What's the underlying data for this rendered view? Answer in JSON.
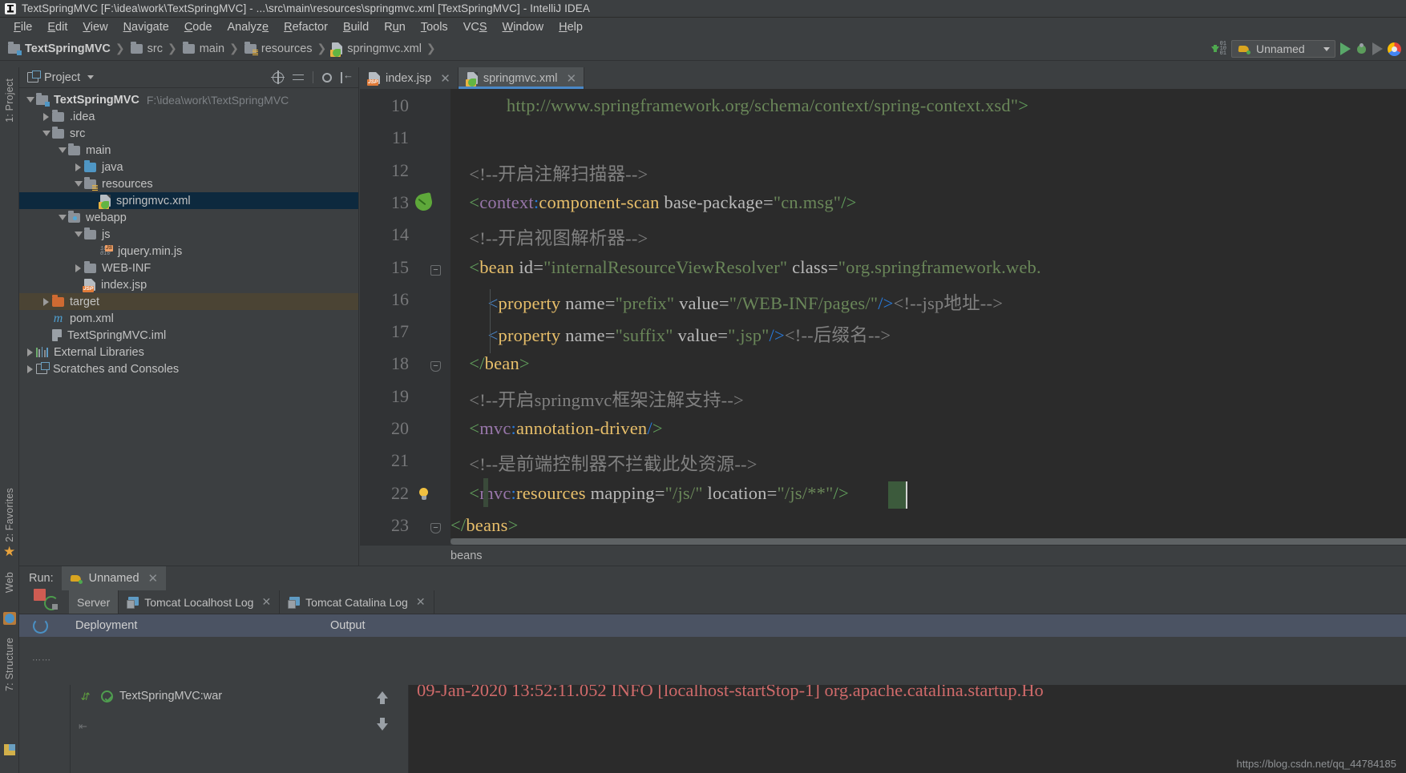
{
  "window": {
    "title": "TextSpringMVC [F:\\idea\\work\\TextSpringMVC] - ...\\src\\main\\resources\\springmvc.xml [TextSpringMVC] - IntelliJ IDEA",
    "logo_icon": "intellij-logo-icon"
  },
  "menubar": {
    "items": [
      "File",
      "Edit",
      "View",
      "Navigate",
      "Code",
      "Analyze",
      "Refactor",
      "Build",
      "Run",
      "Tools",
      "VCS",
      "Window",
      "Help"
    ]
  },
  "navbar": {
    "breadcrumbs": [
      {
        "label": "TextSpringMVC",
        "icon": "module-icon",
        "bold": true
      },
      {
        "label": "src",
        "icon": "folder-icon",
        "bold": false
      },
      {
        "label": "main",
        "icon": "folder-icon",
        "bold": false
      },
      {
        "label": "resources",
        "icon": "resources-folder-icon",
        "bold": false
      },
      {
        "label": "springmvc.xml",
        "icon": "spring-xml-icon",
        "bold": false
      }
    ],
    "run_config": {
      "label": "Unnamed",
      "icon": "tomcat-icon",
      "dropdown_icon": "chevron-down-icon"
    },
    "actions": [
      "update-running-app-icon",
      "run-icon",
      "debug-icon",
      "run-with-coverage-icon",
      "chrome-icon"
    ]
  },
  "left_strips": {
    "project_label": "1: Project",
    "favorites_label": "2: Favorites",
    "web_label": "Web",
    "structure_label": "7: Structure"
  },
  "project_panel": {
    "title": "Project",
    "title_icon": "project-view-icon",
    "dropdown_icon": "chevron-down-icon",
    "toolbar_icons": [
      "locate-icon",
      "collapse-all-icon",
      "settings-icon",
      "hide-icon"
    ],
    "tree": [
      {
        "label": "TextSpringMVC",
        "secondary": "F:\\idea\\work\\TextSpringMVC",
        "indent": 0,
        "twisty": "expanded",
        "icon": "module-icon",
        "bold": true,
        "state": "normal"
      },
      {
        "label": ".idea",
        "secondary": "",
        "indent": 1,
        "twisty": "collapsed",
        "icon": "folder-icon",
        "bold": false,
        "state": "normal"
      },
      {
        "label": "src",
        "secondary": "",
        "indent": 1,
        "twisty": "expanded",
        "icon": "folder-icon",
        "bold": false,
        "state": "normal"
      },
      {
        "label": "main",
        "secondary": "",
        "indent": 2,
        "twisty": "expanded",
        "icon": "folder-icon",
        "bold": false,
        "state": "normal"
      },
      {
        "label": "java",
        "secondary": "",
        "indent": 3,
        "twisty": "collapsed",
        "icon": "source-folder-icon",
        "bold": false,
        "state": "normal"
      },
      {
        "label": "resources",
        "secondary": "",
        "indent": 3,
        "twisty": "expanded",
        "icon": "resources-folder-icon",
        "bold": false,
        "state": "normal"
      },
      {
        "label": "springmvc.xml",
        "secondary": "",
        "indent": 4,
        "twisty": "none",
        "icon": "spring-xml-icon",
        "bold": false,
        "state": "selected"
      },
      {
        "label": "webapp",
        "secondary": "",
        "indent": 2,
        "twisty": "expanded",
        "icon": "webapp-folder-icon",
        "bold": false,
        "state": "normal"
      },
      {
        "label": "js",
        "secondary": "",
        "indent": 3,
        "twisty": "expanded",
        "icon": "folder-icon",
        "bold": false,
        "state": "normal"
      },
      {
        "label": "jquery.min.js",
        "secondary": "",
        "indent": 4,
        "twisty": "none",
        "icon": "javascript-file-icon",
        "bold": false,
        "state": "normal"
      },
      {
        "label": "WEB-INF",
        "secondary": "",
        "indent": 3,
        "twisty": "collapsed",
        "icon": "folder-icon",
        "bold": false,
        "state": "normal"
      },
      {
        "label": "index.jsp",
        "secondary": "",
        "indent": 3,
        "twisty": "none",
        "icon": "jsp-file-icon",
        "bold": false,
        "state": "normal"
      },
      {
        "label": "target",
        "secondary": "",
        "indent": 1,
        "twisty": "collapsed",
        "icon": "excluded-folder-icon",
        "bold": false,
        "state": "highlighted"
      },
      {
        "label": "pom.xml",
        "secondary": "",
        "indent": 1,
        "twisty": "none",
        "icon": "maven-pom-icon",
        "bold": false,
        "state": "normal"
      },
      {
        "label": "TextSpringMVC.iml",
        "secondary": "",
        "indent": 1,
        "twisty": "none",
        "icon": "iml-file-icon",
        "bold": false,
        "state": "normal"
      },
      {
        "label": "External Libraries",
        "secondary": "",
        "indent": 0,
        "twisty": "collapsed",
        "icon": "libraries-icon",
        "bold": false,
        "state": "normal"
      },
      {
        "label": "Scratches and Consoles",
        "secondary": "",
        "indent": 0,
        "twisty": "collapsed",
        "icon": "scratches-icon",
        "bold": false,
        "state": "normal"
      }
    ]
  },
  "editor": {
    "tabs": [
      {
        "label": "index.jsp",
        "icon": "jsp-file-icon",
        "active": false,
        "close_icon": "close-icon"
      },
      {
        "label": "springmvc.xml",
        "icon": "spring-xml-icon",
        "active": true,
        "close_icon": "close-icon"
      }
    ],
    "breadcrumb_status": "beans",
    "first_line_number": 10,
    "lines": [
      {
        "n": 10,
        "segments": [
          {
            "t": "            ",
            "c": "at"
          },
          {
            "t": "http://www.springframework.org/schema/context/spring-context.xsd",
            "c": "st2"
          },
          {
            "t": "\"",
            "c": "st2"
          },
          {
            "t": ">",
            "c": "br"
          }
        ]
      },
      {
        "n": 11,
        "segments": []
      },
      {
        "n": 12,
        "segments": [
          {
            "t": "    <!--开启注解扫描器-->",
            "c": "cm"
          }
        ]
      },
      {
        "n": 13,
        "segments": [
          {
            "t": "    <",
            "c": "br"
          },
          {
            "t": "context",
            "c": "ns"
          },
          {
            "t": ":",
            "c": "bl"
          },
          {
            "t": "component-scan ",
            "c": "tg"
          },
          {
            "t": "base-package",
            "c": "at"
          },
          {
            "t": "=",
            "c": "at"
          },
          {
            "t": "\"cn.msg\"",
            "c": "st2"
          },
          {
            "t": "/>",
            "c": "br"
          }
        ]
      },
      {
        "n": 14,
        "segments": [
          {
            "t": "    <!--开启视图解析器-->",
            "c": "cm"
          }
        ]
      },
      {
        "n": 15,
        "segments": [
          {
            "t": "    <",
            "c": "br"
          },
          {
            "t": "bean ",
            "c": "tg"
          },
          {
            "t": "id",
            "c": "at"
          },
          {
            "t": "=",
            "c": "at"
          },
          {
            "t": "\"internalResourceViewResolver\"",
            "c": "st2"
          },
          {
            "t": " ",
            "c": "at"
          },
          {
            "t": "class",
            "c": "at"
          },
          {
            "t": "=",
            "c": "at"
          },
          {
            "t": "\"org.springframework.web.",
            "c": "st2"
          }
        ]
      },
      {
        "n": 16,
        "segments": [
          {
            "t": "        <",
            "c": "pr"
          },
          {
            "t": "property ",
            "c": "tg"
          },
          {
            "t": "name",
            "c": "at"
          },
          {
            "t": "=",
            "c": "at"
          },
          {
            "t": "\"prefix\"",
            "c": "st2"
          },
          {
            "t": " ",
            "c": "at"
          },
          {
            "t": "value",
            "c": "at"
          },
          {
            "t": "=",
            "c": "at"
          },
          {
            "t": "\"/WEB-INF/pages/\"",
            "c": "st2"
          },
          {
            "t": "/>",
            "c": "bl"
          },
          {
            "t": "<!--jsp地址-->",
            "c": "cm"
          }
        ]
      },
      {
        "n": 17,
        "segments": [
          {
            "t": "        <",
            "c": "pr"
          },
          {
            "t": "property ",
            "c": "tg"
          },
          {
            "t": "name",
            "c": "at"
          },
          {
            "t": "=",
            "c": "at"
          },
          {
            "t": "\"suffix\"",
            "c": "st2"
          },
          {
            "t": " ",
            "c": "at"
          },
          {
            "t": "value",
            "c": "at"
          },
          {
            "t": "=",
            "c": "at"
          },
          {
            "t": "\".jsp\"",
            "c": "st2"
          },
          {
            "t": "/>",
            "c": "bl"
          },
          {
            "t": "<!--后缀名-->",
            "c": "cm"
          }
        ]
      },
      {
        "n": 18,
        "segments": [
          {
            "t": "    </",
            "c": "br"
          },
          {
            "t": "bean",
            "c": "tg"
          },
          {
            "t": ">",
            "c": "br"
          }
        ]
      },
      {
        "n": 19,
        "segments": [
          {
            "t": "    <!--开启springmvc框架注解支持-->",
            "c": "cm"
          }
        ]
      },
      {
        "n": 20,
        "segments": [
          {
            "t": "    <",
            "c": "br"
          },
          {
            "t": "mvc",
            "c": "ns"
          },
          {
            "t": ":",
            "c": "bl"
          },
          {
            "t": "annotation-driven",
            "c": "tg"
          },
          {
            "t": "/",
            "c": "bl"
          },
          {
            "t": ">",
            "c": "br"
          }
        ]
      },
      {
        "n": 21,
        "segments": [
          {
            "t": "    <!--是前端控制器不拦截此处资源-->",
            "c": "cm"
          }
        ]
      },
      {
        "n": 22,
        "segments": [
          {
            "t": "    <",
            "c": "br"
          },
          {
            "t": "mvc",
            "c": "ns"
          },
          {
            "t": ":",
            "c": "bl"
          },
          {
            "t": "resources ",
            "c": "tg"
          },
          {
            "t": "mapping",
            "c": "at"
          },
          {
            "t": "=",
            "c": "at"
          },
          {
            "t": "\"/js/\"",
            "c": "st2"
          },
          {
            "t": " ",
            "c": "at"
          },
          {
            "t": "location",
            "c": "at"
          },
          {
            "t": "=",
            "c": "at"
          },
          {
            "t": "\"/js/**\"",
            "c": "st2"
          },
          {
            "t": "/>",
            "c": "br"
          }
        ]
      },
      {
        "n": 23,
        "segments": [
          {
            "t": "</",
            "c": "br"
          },
          {
            "t": "beans",
            "c": "tg"
          },
          {
            "t": ">",
            "c": "br"
          }
        ]
      }
    ],
    "gutter_markers": [
      {
        "line": 13,
        "type": "spring-bean-gutter-icon"
      },
      {
        "line": 15,
        "type": "fold-collapse-icon"
      },
      {
        "line": 18,
        "type": "fold-collapse-end-icon"
      },
      {
        "line": 22,
        "type": "intention-bulb-icon"
      },
      {
        "line": 23,
        "type": "fold-collapse-end-icon"
      }
    ]
  },
  "run_panel": {
    "run_label": "Run:",
    "tab": {
      "label": "Unnamed",
      "icon": "tomcat-icon",
      "close_icon": "close-icon"
    },
    "rerun_icon": "rerun-icon",
    "sub_tabs": [
      {
        "label": "Server",
        "icon": "",
        "active": true,
        "closeable": false
      },
      {
        "label": "Tomcat Localhost Log",
        "icon": "log-icon",
        "active": false,
        "closeable": true
      },
      {
        "label": "Tomcat Catalina Log",
        "icon": "log-icon",
        "active": false,
        "closeable": true
      }
    ],
    "columns": {
      "deployment": "Deployment",
      "output": "Output"
    },
    "deployment_items": [
      {
        "label": "TextSpringMVC:war",
        "status_icon": "ok-circle-icon"
      }
    ],
    "side_icons": [
      "stop-icon",
      "rerun-server-icon"
    ],
    "output_scroll_icons": [
      "scroll-up-icon",
      "scroll-down-icon"
    ],
    "console_line": "09-Jan-2020 13:52:11.052 INFO [localhost-startStop-1] org.apache.catalina.startup.Ho",
    "watermark": "https://blog.csdn.net/qq_44784185"
  }
}
